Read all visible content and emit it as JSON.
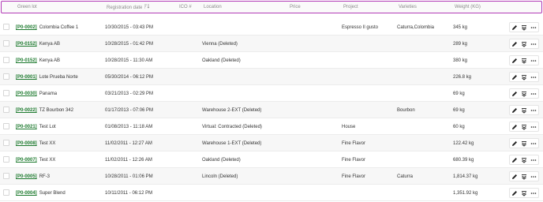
{
  "columns": {
    "green_lot": "Green lot",
    "registration_date": "Registration date",
    "ico": "ICO #",
    "location": "Location",
    "price": "Price",
    "project": "Project",
    "varieties": "Varieties",
    "weight": "Weight (KG)"
  },
  "icons": {
    "sort": "sort-icon",
    "edit": "pencil-icon",
    "transfer": "double-chevron-down-icon",
    "more": "ellipsis-icon"
  },
  "colors": {
    "accent": "#b23bb6",
    "link": "#1d7a2e"
  },
  "rows": [
    {
      "code": "[P0-0002]",
      "name": "Colombia Coffee 1",
      "date": "10/30/2015 - 03:43 PM",
      "ico": "",
      "location": "",
      "price": "",
      "project": "Espresso Il gusto",
      "varieties": "Caturra,Colombia",
      "weight": "345 kg"
    },
    {
      "code": "[P0-0152]",
      "name": "Kenya AB",
      "date": "10/28/2015 - 01:42 PM",
      "ico": "",
      "location": "Vienna (Deleted)",
      "price": "",
      "project": "",
      "varieties": "",
      "weight": "289 kg"
    },
    {
      "code": "[P0-0152]",
      "name": "Kenya AB",
      "date": "10/28/2015 - 11:30 AM",
      "ico": "",
      "location": "Oakland (Deleted)",
      "price": "",
      "project": "",
      "varieties": "",
      "weight": "380 kg"
    },
    {
      "code": "[P0-0001]",
      "name": "Lote Prueba Norte",
      "date": "05/30/2014 - 06:12 PM",
      "ico": "",
      "location": "",
      "price": "",
      "project": "",
      "varieties": "",
      "weight": "226.8 kg"
    },
    {
      "code": "[P0-0030]",
      "name": "Panama",
      "date": "03/21/2013 - 02:29 PM",
      "ico": "",
      "location": "",
      "price": "",
      "project": "",
      "varieties": "",
      "weight": "69 kg"
    },
    {
      "code": "[P0-0022]",
      "name": "TZ Bourbon 342",
      "date": "01/17/2013 - 07:06 PM",
      "ico": "",
      "location": "Warehouse 2-EXT (Deleted)",
      "price": "",
      "project": "",
      "varieties": "Bourbon",
      "weight": "69 kg"
    },
    {
      "code": "[P0-0021]",
      "name": "Test Lot",
      "date": "01/08/2013 - 11:18 AM",
      "ico": "",
      "location": "Virtual: Contracted (Deleted)",
      "price": "",
      "project": "House",
      "varieties": "",
      "weight": "60 kg"
    },
    {
      "code": "[P0-0008]",
      "name": "Test XX",
      "date": "11/02/2011 - 12:27 AM",
      "ico": "",
      "location": "Warehouse 1-EXT (Deleted)",
      "price": "",
      "project": "Fine Flavor",
      "varieties": "",
      "weight": "122.42 kg"
    },
    {
      "code": "[P0-0007]",
      "name": "Test XX",
      "date": "11/02/2011 - 12:26 AM",
      "ico": "",
      "location": "Oakland (Deleted)",
      "price": "",
      "project": "Fine Flavor",
      "varieties": "",
      "weight": "680.39 kg"
    },
    {
      "code": "[P0-0005]",
      "name": "RF-3",
      "date": "10/28/2011 - 01:06 PM",
      "ico": "",
      "location": "Lincoln (Deleted)",
      "price": "",
      "project": "Fine Flavor",
      "varieties": "Caturra",
      "weight": "1,814.37 kg"
    },
    {
      "code": "[P0-0004]",
      "name": "Super Blend",
      "date": "10/11/2011 - 06:12 PM",
      "ico": "",
      "location": "",
      "price": "",
      "project": "",
      "varieties": "",
      "weight": "1,351.92 kg"
    }
  ]
}
